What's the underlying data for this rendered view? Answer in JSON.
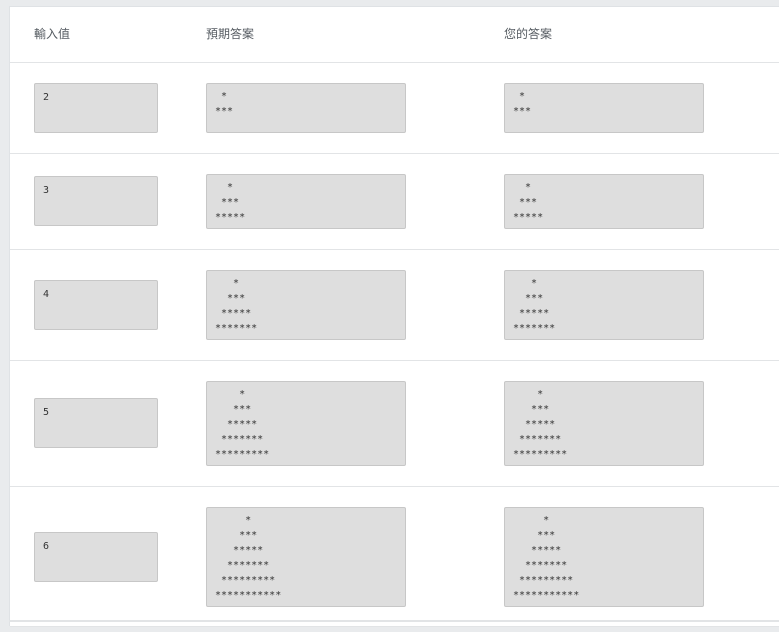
{
  "headers": {
    "input": "輸入值",
    "expected": "預期答案",
    "actual": "您的答案"
  },
  "rows": [
    {
      "input": "2",
      "expected": " *\n***",
      "actual": " *\n***"
    },
    {
      "input": "3",
      "expected": "  *\n ***\n*****",
      "actual": "  *\n ***\n*****"
    },
    {
      "input": "4",
      "expected": "   *\n  ***\n *****\n*******",
      "actual": "   *\n  ***\n *****\n*******"
    },
    {
      "input": "5",
      "expected": "    *\n   ***\n  *****\n *******\n*********",
      "actual": "    *\n   ***\n  *****\n *******\n*********"
    },
    {
      "input": "6",
      "expected": "     *\n    ***\n   *****\n  *******\n *********\n***********",
      "actual": "     *\n    ***\n   *****\n  *******\n *********\n***********"
    }
  ]
}
